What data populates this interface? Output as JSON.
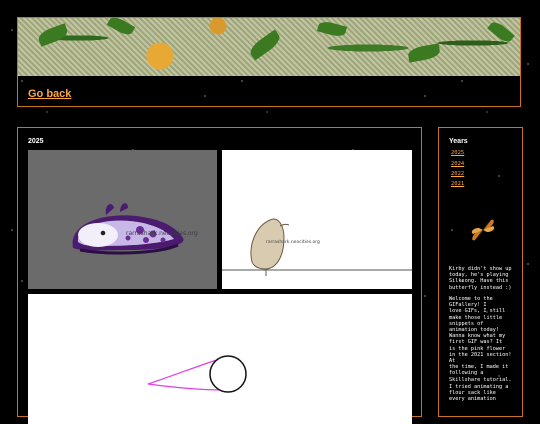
{
  "header": {
    "go_back_label": "Go back"
  },
  "main": {
    "year_heading": "2025"
  },
  "gifs": [
    {
      "watermark": "rarrashark.neocities.org"
    },
    {
      "watermark": "rarrashark.neocities.org"
    }
  ],
  "sidebar": {
    "title": "Years",
    "years": [
      "2025",
      "2024",
      "2022",
      "2021"
    ],
    "para1": "Kirby didn't show up\ntoday, he's playing\nSilksong. Have this\nbutterfly instead :)",
    "para2": "Welcome to the\nGIFallery! I\nlove GIFs, I still\nmake those little\nsnippets of\nanimation today!\nWanna know what my\nfirst GIF was? It\nis the pink flower\nin the 2021 section! At\nthe time, I made it\nfollowing a\nSkillshare tutorial.",
    "para3": "I tried animating a\nflour sack like\nevery animation"
  },
  "colors": {
    "accent": "#ffa641",
    "border": "#c9731f",
    "nudibranch": "#4b1b6f",
    "flower": "#e040e0"
  }
}
